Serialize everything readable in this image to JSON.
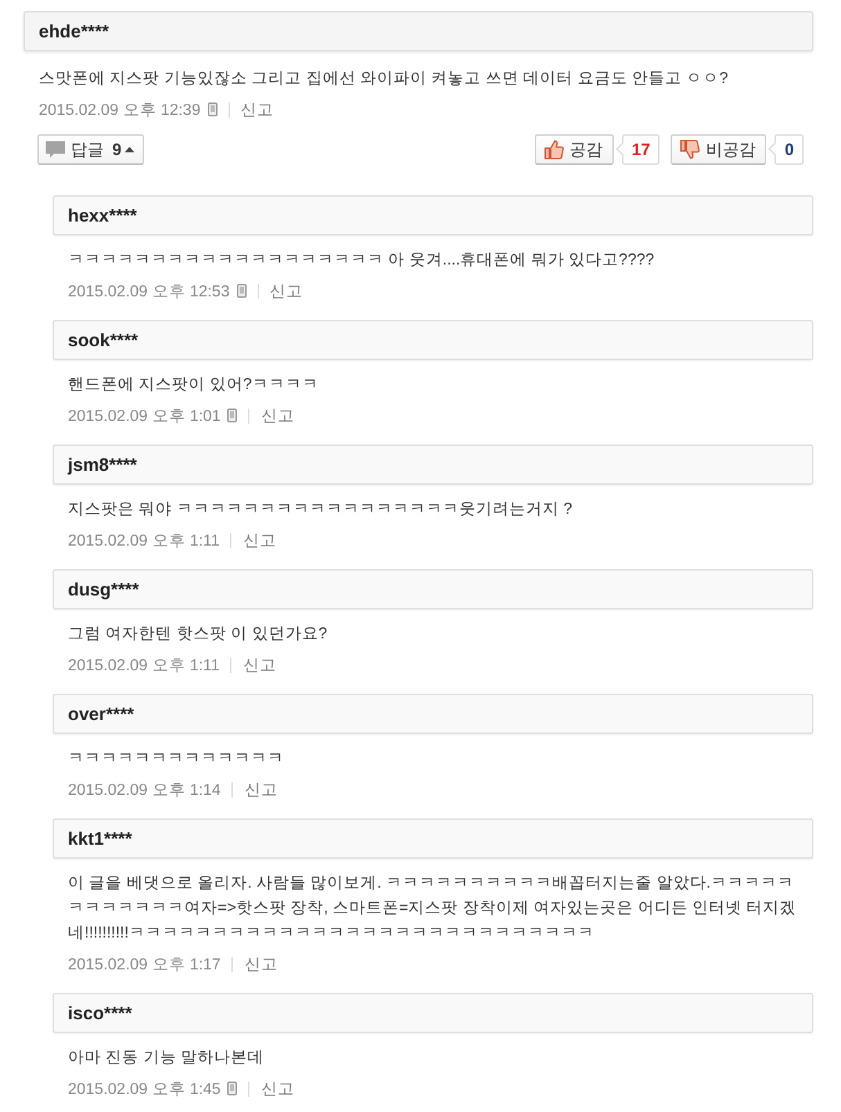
{
  "comment": {
    "author": "ehde****",
    "text": "스맛폰에 지스팟 기능있잖소 그리고 집에선 와이파이 켜놓고 쓰면 데이터 요금도 안들고 ㅇㅇ?",
    "date": "2015.02.09 오후 12:39",
    "mobile": true,
    "report": "신고",
    "reply_button": {
      "label": "답글",
      "count": "9",
      "expanded": true
    },
    "like": {
      "label": "공감",
      "count": "17"
    },
    "dislike": {
      "label": "비공감",
      "count": "0"
    }
  },
  "replies": [
    {
      "author": "hexx****",
      "text": "ㅋㅋㅋㅋㅋㅋㅋㅋㅋㅋㅋㅋㅋㅋㅋㅋㅋㅋㅋ 아 웃겨....휴대폰에 뭐가 있다고????",
      "date": "2015.02.09 오후 12:53",
      "mobile": true,
      "report": "신고"
    },
    {
      "author": "sook****",
      "text": "핸드폰에 지스팟이 있어?ㅋㅋㅋㅋ",
      "date": "2015.02.09 오후 1:01",
      "mobile": true,
      "report": "신고"
    },
    {
      "author": "jsm8****",
      "text": "지스팟은 뭐야 ㅋㅋㅋㅋㅋㅋㅋㅋㅋㅋㅋㅋㅋㅋㅋㅋㅋ웃기려는거지 ?",
      "date": "2015.02.09 오후 1:11",
      "mobile": false,
      "report": "신고"
    },
    {
      "author": "dusg****",
      "text": "그럼 여자한텐 핫스팟 이 있던가요?",
      "date": "2015.02.09 오후 1:11",
      "mobile": false,
      "report": "신고"
    },
    {
      "author": "over****",
      "text": "ㅋㅋㅋㅋㅋㅋㅋㅋㅋㅋㅋㅋㅋ",
      "date": "2015.02.09 오후 1:14",
      "mobile": false,
      "report": "신고"
    },
    {
      "author": "kkt1****",
      "text": "이 글을 베댓으로 올리자. 사람들 많이보게. ㅋㅋㅋㅋㅋㅋㅋㅋㅋㅋ배꼽터지는줄 알았다.ㅋㅋㅋㅋㅋㅋㅋㅋㅋㅋㅋㅋ여자=>핫스팟 장착, 스마트폰=지스팟 장착이제 여자있는곳은 어디든 인터넷 터지겠네!!!!!!!!!!ㅋㅋㅋㅋㅋㅋㅋㅋㅋㅋㅋㅋㅋㅋㅋㅋㅋㅋㅋㅋㅋㅋㅋㅋㅋㅋㅋㅋ",
      "date": "2015.02.09 오후 1:17",
      "mobile": false,
      "report": "신고"
    },
    {
      "author": "isco****",
      "text": "아마 진동 기능 말하나본데",
      "date": "2015.02.09 오후 1:45",
      "mobile": true,
      "report": "신고"
    }
  ]
}
